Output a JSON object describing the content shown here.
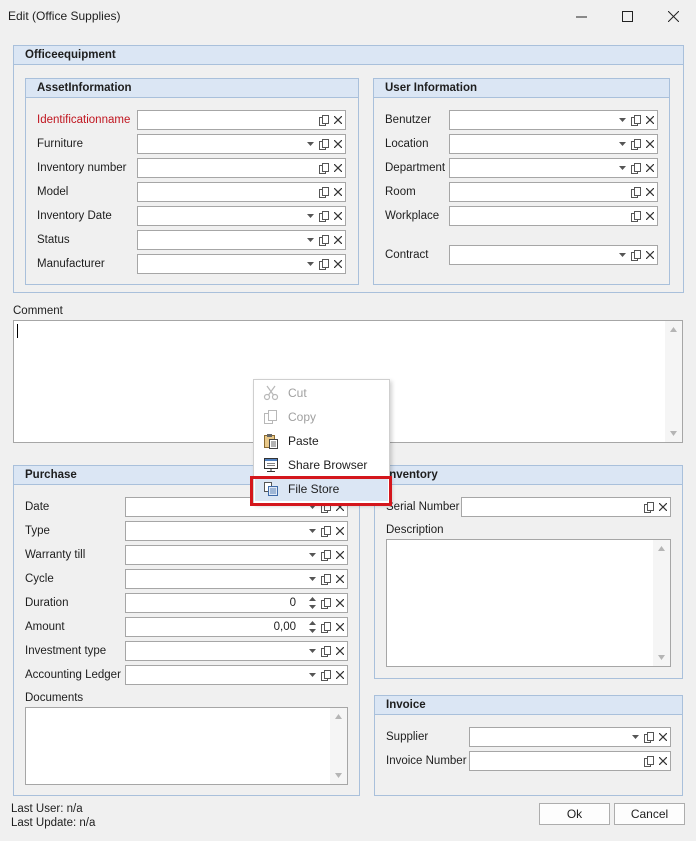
{
  "window": {
    "title": "Edit (Office Supplies)"
  },
  "office": {
    "title": "Officeequipment"
  },
  "asset": {
    "title": "AssetInformation",
    "fields": [
      {
        "label": "Identificationname",
        "value": ""
      },
      {
        "label": "Furniture",
        "value": ""
      },
      {
        "label": "Inventory number",
        "value": ""
      },
      {
        "label": "Model",
        "value": ""
      },
      {
        "label": "Inventory Date",
        "value": ""
      },
      {
        "label": "Status",
        "value": ""
      },
      {
        "label": "Manufacturer",
        "value": ""
      }
    ]
  },
  "user": {
    "title": "User Information",
    "fields": [
      {
        "label": "Benutzer",
        "value": ""
      },
      {
        "label": "Location",
        "value": ""
      },
      {
        "label": "Department",
        "value": ""
      },
      {
        "label": "Room",
        "value": ""
      },
      {
        "label": "Workplace",
        "value": ""
      },
      {
        "label": "Contract",
        "value": ""
      }
    ]
  },
  "comment": {
    "label": "Comment",
    "value": ""
  },
  "purchase": {
    "title": "Purchase",
    "fields": [
      {
        "label": "Date",
        "value": ""
      },
      {
        "label": "Type",
        "value": ""
      },
      {
        "label": "Warranty till",
        "value": ""
      },
      {
        "label": "Cycle",
        "value": ""
      },
      {
        "label": "Duration",
        "value": "0"
      },
      {
        "label": "Amount",
        "value": "0,00"
      },
      {
        "label": "Investment type",
        "value": ""
      },
      {
        "label": "Accounting Ledger",
        "value": ""
      }
    ],
    "documents_label": "Documents"
  },
  "inventory": {
    "title": "Inventory",
    "serial_label": "Serial Number",
    "serial_value": "",
    "description_label": "Description"
  },
  "invoice": {
    "title": "Invoice",
    "supplier_label": "Supplier",
    "number_label": "Invoice Number"
  },
  "footer": {
    "last_user": "Last User: n/a",
    "last_update": "Last Update: n/a",
    "ok": "Ok",
    "cancel": "Cancel"
  },
  "context_menu": {
    "items": [
      {
        "label": "Cut",
        "icon": "scissors-icon",
        "enabled": false
      },
      {
        "label": "Copy",
        "icon": "copy-icon",
        "enabled": false
      },
      {
        "label": "Paste",
        "icon": "paste-icon",
        "enabled": true
      },
      {
        "label": "Share Browser",
        "icon": "share-browser-icon",
        "enabled": true
      },
      {
        "label": "File Store",
        "icon": "file-store-icon",
        "enabled": true,
        "highlighted": true
      }
    ]
  },
  "colors": {
    "group_header": "#dbe6f4",
    "group_border": "#a9c0db",
    "required_label": "#c0151f",
    "highlight_box": "#d4161c"
  }
}
